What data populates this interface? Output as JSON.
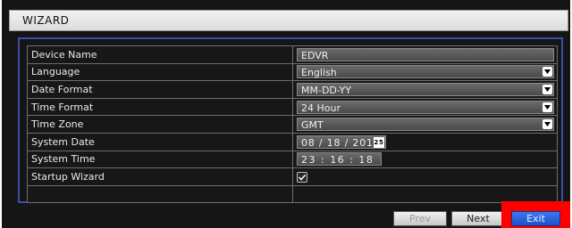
{
  "window": {
    "title": "WIZARD"
  },
  "form": {
    "rows": [
      {
        "label": "Device Name",
        "value": "EDVR"
      },
      {
        "label": "Language",
        "value": "English"
      },
      {
        "label": "Date Format",
        "value": "MM-DD-YY"
      },
      {
        "label": "Time Format",
        "value": "24 Hour"
      },
      {
        "label": "Time Zone",
        "value": "GMT"
      },
      {
        "label": "System Date",
        "value": "08 / 18 / 2015",
        "calendar_badge": "25"
      },
      {
        "label": "System Time",
        "value": "23 : 16 : 18"
      },
      {
        "label": "Startup Wizard",
        "checked": true
      }
    ]
  },
  "buttons": {
    "prev": "Prev",
    "next": "Next",
    "exit": "Exit"
  },
  "colors": {
    "panel_border": "#3b4fa8",
    "highlight": "#ff0000",
    "exit_button": "#1d4fc8"
  }
}
